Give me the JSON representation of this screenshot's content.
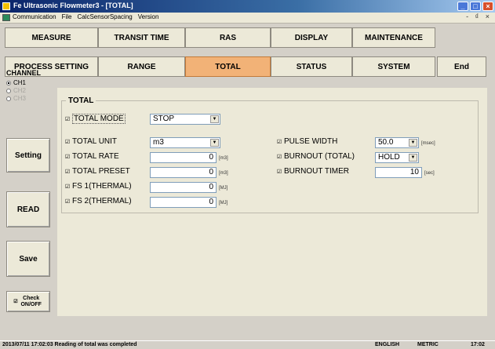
{
  "window": {
    "title": "Fe Ultrasonic Flowmeter3 - [TOTAL]",
    "controls": [
      "minimize",
      "maximize",
      "close"
    ]
  },
  "menubar": {
    "items": [
      "Communication",
      "File",
      "CalcSensorSpacing",
      "Version"
    ],
    "mdi_controls": "- ₫ ×"
  },
  "tabs": {
    "row1": [
      "MEASURE",
      "TRANSIT TIME",
      "RAS",
      "DISPLAY",
      "MAINTENANCE"
    ],
    "row2": [
      "PROCESS SETTING",
      "RANGE",
      "TOTAL",
      "STATUS",
      "SYSTEM"
    ],
    "active": "TOTAL",
    "end_label": "End"
  },
  "channel": {
    "label": "CHANNEL",
    "options": [
      "CH1",
      "CH2",
      "CH3"
    ],
    "selected": "CH1"
  },
  "side_buttons": {
    "setting": "Setting",
    "read": "READ",
    "save": "Save",
    "check": "Check ON/OFF"
  },
  "total": {
    "group_label": "TOTAL",
    "total_mode": {
      "label": "TOTAL MODE",
      "value": "STOP"
    },
    "total_unit": {
      "label": "TOTAL UNIT",
      "value": "m3"
    },
    "total_rate": {
      "label": "TOTAL RATE",
      "value": "0",
      "unit": "[m3]"
    },
    "total_preset": {
      "label": "TOTAL PRESET",
      "value": "0",
      "unit": "[m3]"
    },
    "fs1": {
      "label": "FS 1(THERMAL)",
      "value": "0",
      "unit": "[MJ]"
    },
    "fs2": {
      "label": "FS 2(THERMAL)",
      "value": "0",
      "unit": "[MJ]"
    },
    "pulse_width": {
      "label": "PULSE WIDTH",
      "value": "50.0",
      "unit": "[msec]"
    },
    "burnout_total": {
      "label": "BURNOUT (TOTAL)",
      "value": "HOLD"
    },
    "burnout_timer": {
      "label": "BURNOUT TIMER",
      "value": "10",
      "unit": "[sec]"
    }
  },
  "statusbar": {
    "message": "2013/07/11 17:02:03 Reading of total was completed",
    "language": "ENGLISH",
    "units": "METRIC",
    "time": "17:02"
  },
  "colors": {
    "active_tab": "#f2b277",
    "title_bar": "#0a246a"
  }
}
